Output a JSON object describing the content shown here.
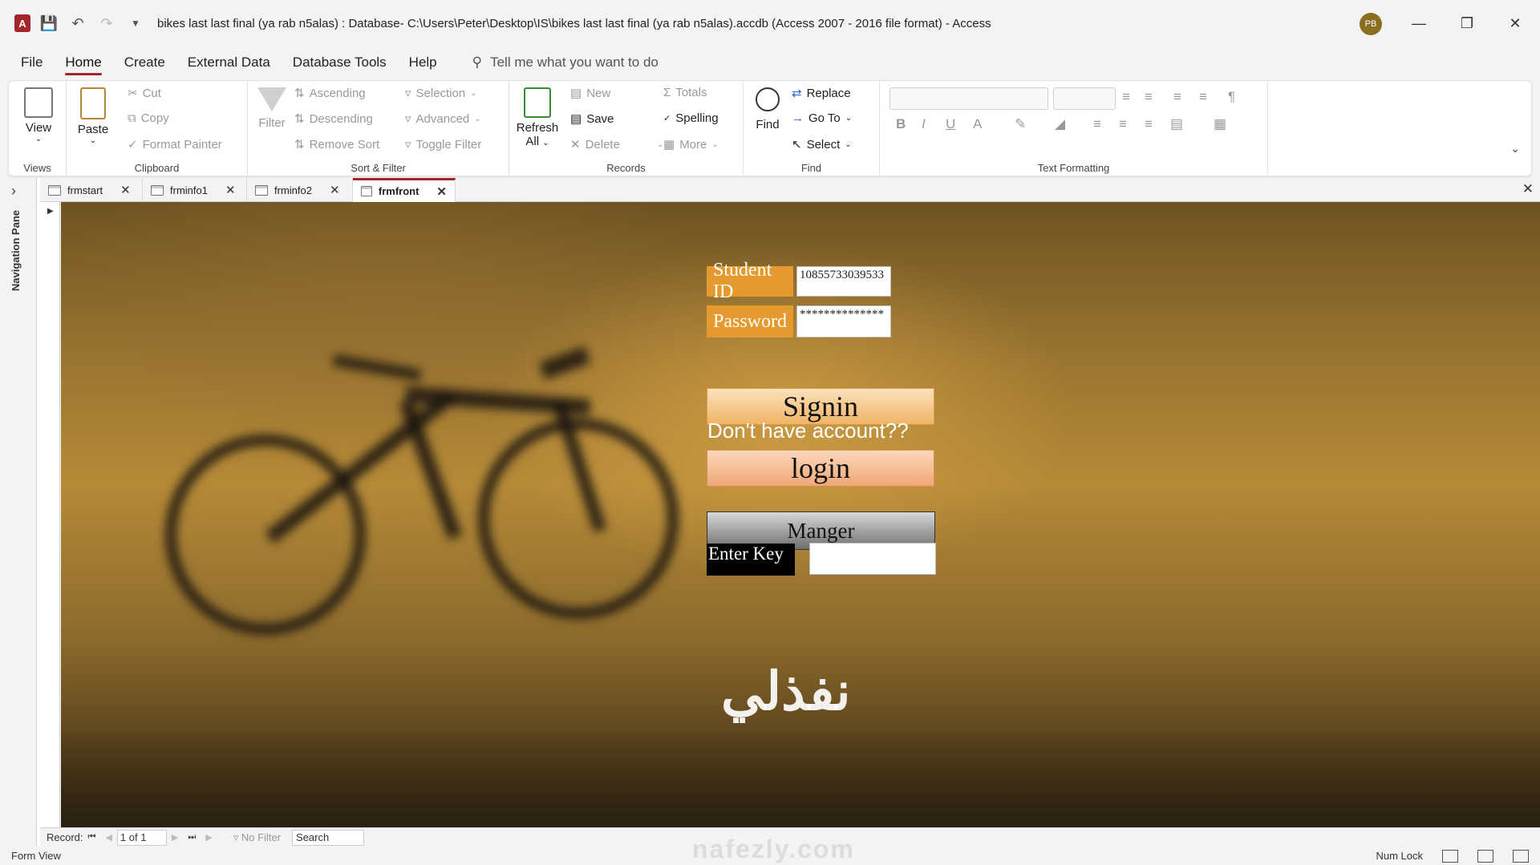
{
  "window": {
    "title": "bikes last last final (ya rab n5alas) : Database- C:\\Users\\Peter\\Desktop\\IS\\bikes last last final (ya rab n5alas).accdb (Access 2007 - 2016 file format)  -  Access",
    "user_initials": "PB",
    "app_logo": "A",
    "accent_color": "#a4262c"
  },
  "menu": {
    "items": [
      "File",
      "Home",
      "Create",
      "External Data",
      "Database Tools",
      "Help"
    ],
    "active": "Home",
    "tell_me": "Tell me what you want to do"
  },
  "ribbon": {
    "views": {
      "label": "Views",
      "view": "View"
    },
    "clipboard": {
      "label": "Clipboard",
      "paste": "Paste",
      "cut": "Cut",
      "copy": "Copy",
      "format_painter": "Format Painter"
    },
    "sort_filter": {
      "label": "Sort & Filter",
      "filter": "Filter",
      "ascending": "Ascending",
      "descending": "Descending",
      "remove_sort": "Remove Sort",
      "selection": "Selection",
      "advanced": "Advanced",
      "toggle_filter": "Toggle Filter"
    },
    "records": {
      "label": "Records",
      "refresh": "Refresh",
      "refresh2": "All",
      "new": "New",
      "save": "Save",
      "delete": "Delete",
      "totals": "Totals",
      "spelling": "Spelling",
      "more": "More"
    },
    "find": {
      "label": "Find",
      "find": "Find",
      "replace": "Replace",
      "goto": "Go To",
      "select": "Select"
    },
    "text_formatting": {
      "label": "Text Formatting"
    }
  },
  "nav_pane": {
    "label": "Navigation Pane"
  },
  "tabs": [
    {
      "name": "frmstart"
    },
    {
      "name": "frminfo1"
    },
    {
      "name": "frminfo2"
    },
    {
      "name": "frmfront"
    }
  ],
  "form": {
    "student_id_label": "Student ID",
    "student_id_value": "10855733039533",
    "password_label": "Password",
    "password_value": "**************",
    "signin": "Signin",
    "dont_have": "Don't have account??",
    "login": "login",
    "manger": "Manger",
    "enter_key": "Enter Key",
    "watermark_ar": "نفذلي",
    "watermark_en": "nafezly.com"
  },
  "record_nav": {
    "record_label": "Record:",
    "current": "1 of 1",
    "no_filter": "No Filter",
    "search": "Search"
  },
  "status": {
    "left": "Form View",
    "num_lock": "Num Lock"
  }
}
